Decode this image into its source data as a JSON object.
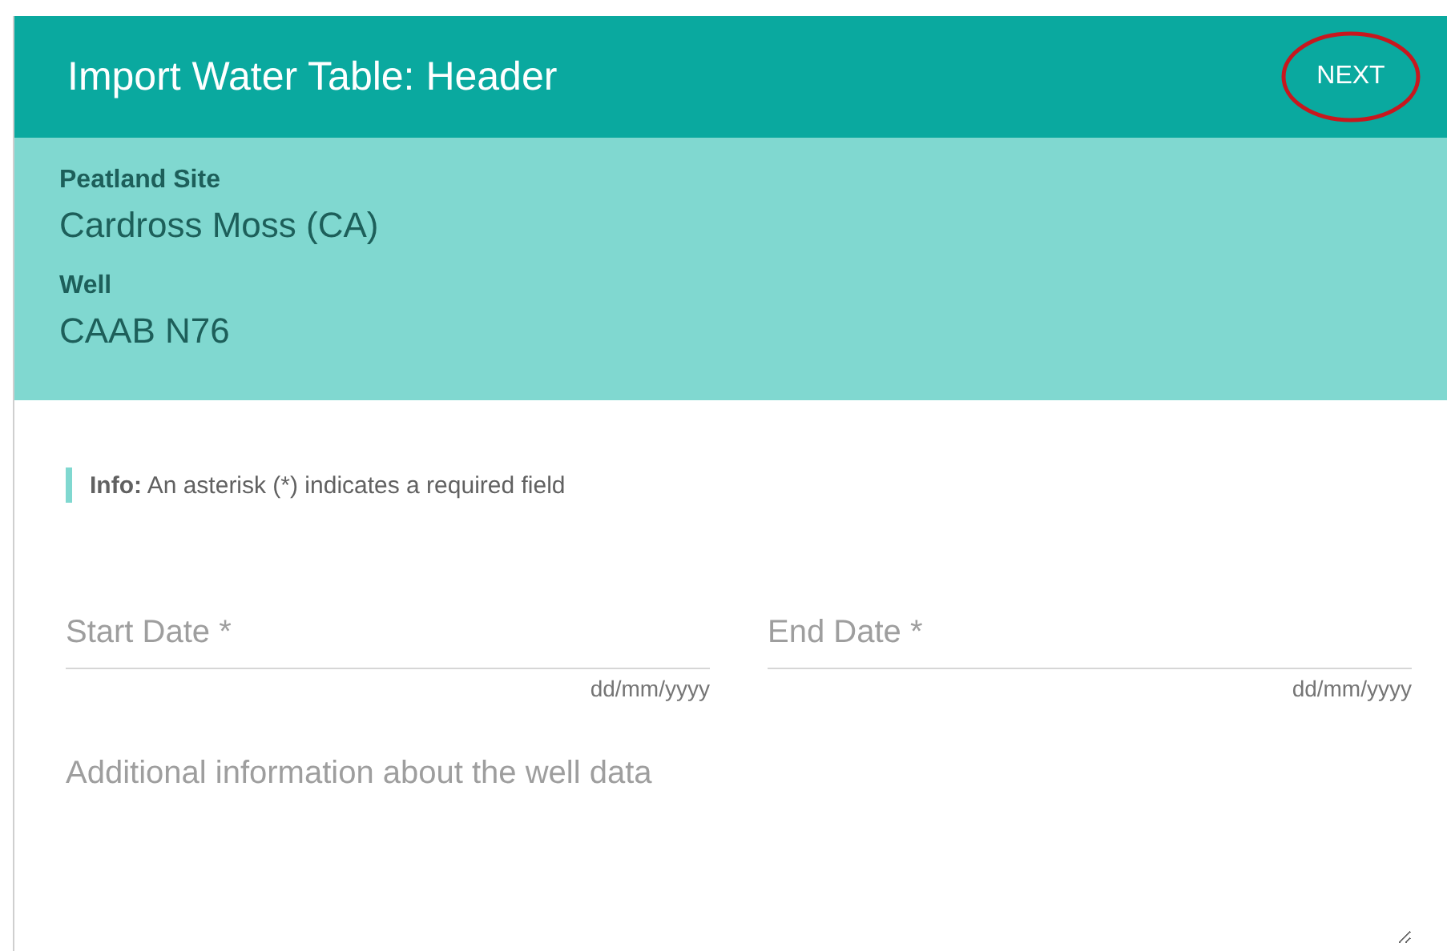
{
  "header": {
    "title": "Import Water Table: Header",
    "next_button": "NEXT"
  },
  "summary": [
    {
      "label": "Peatland Site",
      "value": "Cardross Moss (CA)"
    },
    {
      "label": "Well",
      "value": "CAAB N76"
    }
  ],
  "info": "**Info:** An asterisk (*) indicates a required field",
  "date_fields": [
    {
      "placeholder": "Start Date *",
      "hint": "dd/mm/yyyy"
    },
    {
      "placeholder": "End Date *",
      "hint": "dd/mm/yyyy"
    }
  ],
  "notes": {
    "placeholder": "Additional information about the well data"
  }
}
